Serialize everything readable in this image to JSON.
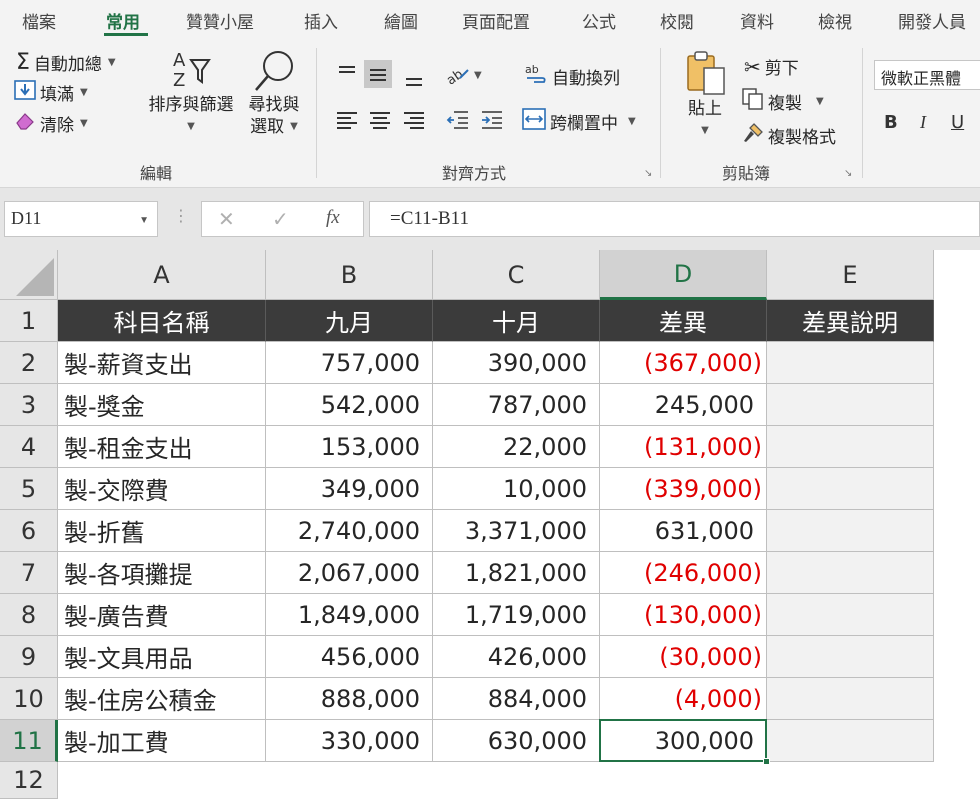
{
  "ribbon_tabs": [
    "檔案",
    "常用",
    "贊贊小屋",
    "插入",
    "繪圖",
    "頁面配置",
    "公式",
    "校閱",
    "資料",
    "檢視",
    "開發人員"
  ],
  "active_tab": "常用",
  "editing": {
    "autosum": "自動加總",
    "fill": "填滿",
    "clear": "清除",
    "sort_filter": "排序與篩選",
    "find_line1": "尋找與",
    "find_line2": "選取",
    "group_label": "編輯"
  },
  "alignment": {
    "wrap_text": "自動換列",
    "merge_center": "跨欄置中",
    "group_label": "對齊方式"
  },
  "clipboard": {
    "paste": "貼上",
    "cut": "剪下",
    "copy": "複製",
    "format_painter": "複製格式",
    "group_label": "剪貼簿"
  },
  "font": {
    "name": "微軟正黑體",
    "bold": "B",
    "italic": "I",
    "underline": "U"
  },
  "formula_bar": {
    "name_box": "D11",
    "fx": "fx",
    "formula": "=C11-B11"
  },
  "sheet": {
    "columns": [
      "A",
      "B",
      "C",
      "D",
      "E"
    ],
    "selected_column": "D",
    "row_numbers": [
      "1",
      "2",
      "3",
      "4",
      "5",
      "6",
      "7",
      "8",
      "9",
      "10",
      "11",
      "12"
    ],
    "selected_row": "11",
    "header": [
      "科目名稱",
      "九月",
      "十月",
      "差異",
      "差異說明"
    ],
    "rows": [
      {
        "name": "製-薪資支出",
        "sep": "757,000",
        "oct": "390,000",
        "diff": "(367,000)",
        "negative": true
      },
      {
        "name": "製-獎金",
        "sep": "542,000",
        "oct": "787,000",
        "diff": "245,000",
        "negative": false
      },
      {
        "name": "製-租金支出",
        "sep": "153,000",
        "oct": "22,000",
        "diff": "(131,000)",
        "negative": true
      },
      {
        "name": "製-交際費",
        "sep": "349,000",
        "oct": "10,000",
        "diff": "(339,000)",
        "negative": true
      },
      {
        "name": "製-折舊",
        "sep": "2,740,000",
        "oct": "3,371,000",
        "diff": "631,000",
        "negative": false
      },
      {
        "name": "製-各項攤提",
        "sep": "2,067,000",
        "oct": "1,821,000",
        "diff": "(246,000)",
        "negative": true
      },
      {
        "name": "製-廣告費",
        "sep": "1,849,000",
        "oct": "1,719,000",
        "diff": "(130,000)",
        "negative": true
      },
      {
        "name": "製-文具用品",
        "sep": "456,000",
        "oct": "426,000",
        "diff": "(30,000)",
        "negative": true
      },
      {
        "name": "製-住房公積金",
        "sep": "888,000",
        "oct": "884,000",
        "diff": "(4,000)",
        "negative": true
      },
      {
        "name": "製-加工費",
        "sep": "330,000",
        "oct": "630,000",
        "diff": "300,000",
        "negative": false
      }
    ]
  },
  "colors": {
    "accent": "#217346",
    "negative": "#e00000",
    "header_fill": "#3b3b3b"
  }
}
